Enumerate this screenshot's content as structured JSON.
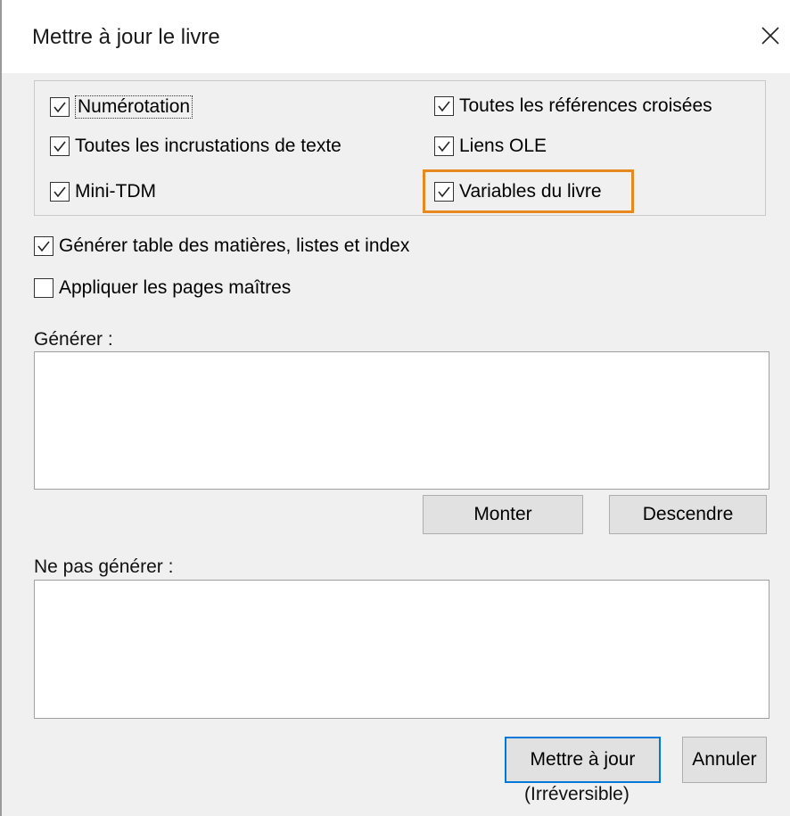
{
  "dialog": {
    "title": "Mettre à jour le livre"
  },
  "options": {
    "numerotation": {
      "label": "Numérotation",
      "checked": true
    },
    "references_croisees": {
      "label": "Toutes les références croisées",
      "checked": true
    },
    "incrustations": {
      "label": "Toutes les incrustations de texte",
      "checked": true
    },
    "liens_ole": {
      "label": "Liens OLE",
      "checked": true
    },
    "mini_tdm": {
      "label": "Mini-TDM",
      "checked": true
    },
    "variables": {
      "label": "Variables du livre",
      "checked": true
    }
  },
  "generer_table": {
    "label": "Générer table des matières, listes et index",
    "checked": true
  },
  "appliquer_pages": {
    "label": "Appliquer les pages maîtres",
    "checked": false
  },
  "generer": {
    "label": "Générer :",
    "items": []
  },
  "ne_pas_generer": {
    "label": "Ne pas générer :",
    "items": []
  },
  "buttons": {
    "monter": "Monter",
    "descendre": "Descendre",
    "mettre_a_jour": "Mettre à jour",
    "annuler": "Annuler"
  },
  "note": "(Irréversible)",
  "colors": {
    "highlight": "#e8891f",
    "default_button_border": "#0078d7",
    "dialog_background": "#f0f0f0"
  }
}
